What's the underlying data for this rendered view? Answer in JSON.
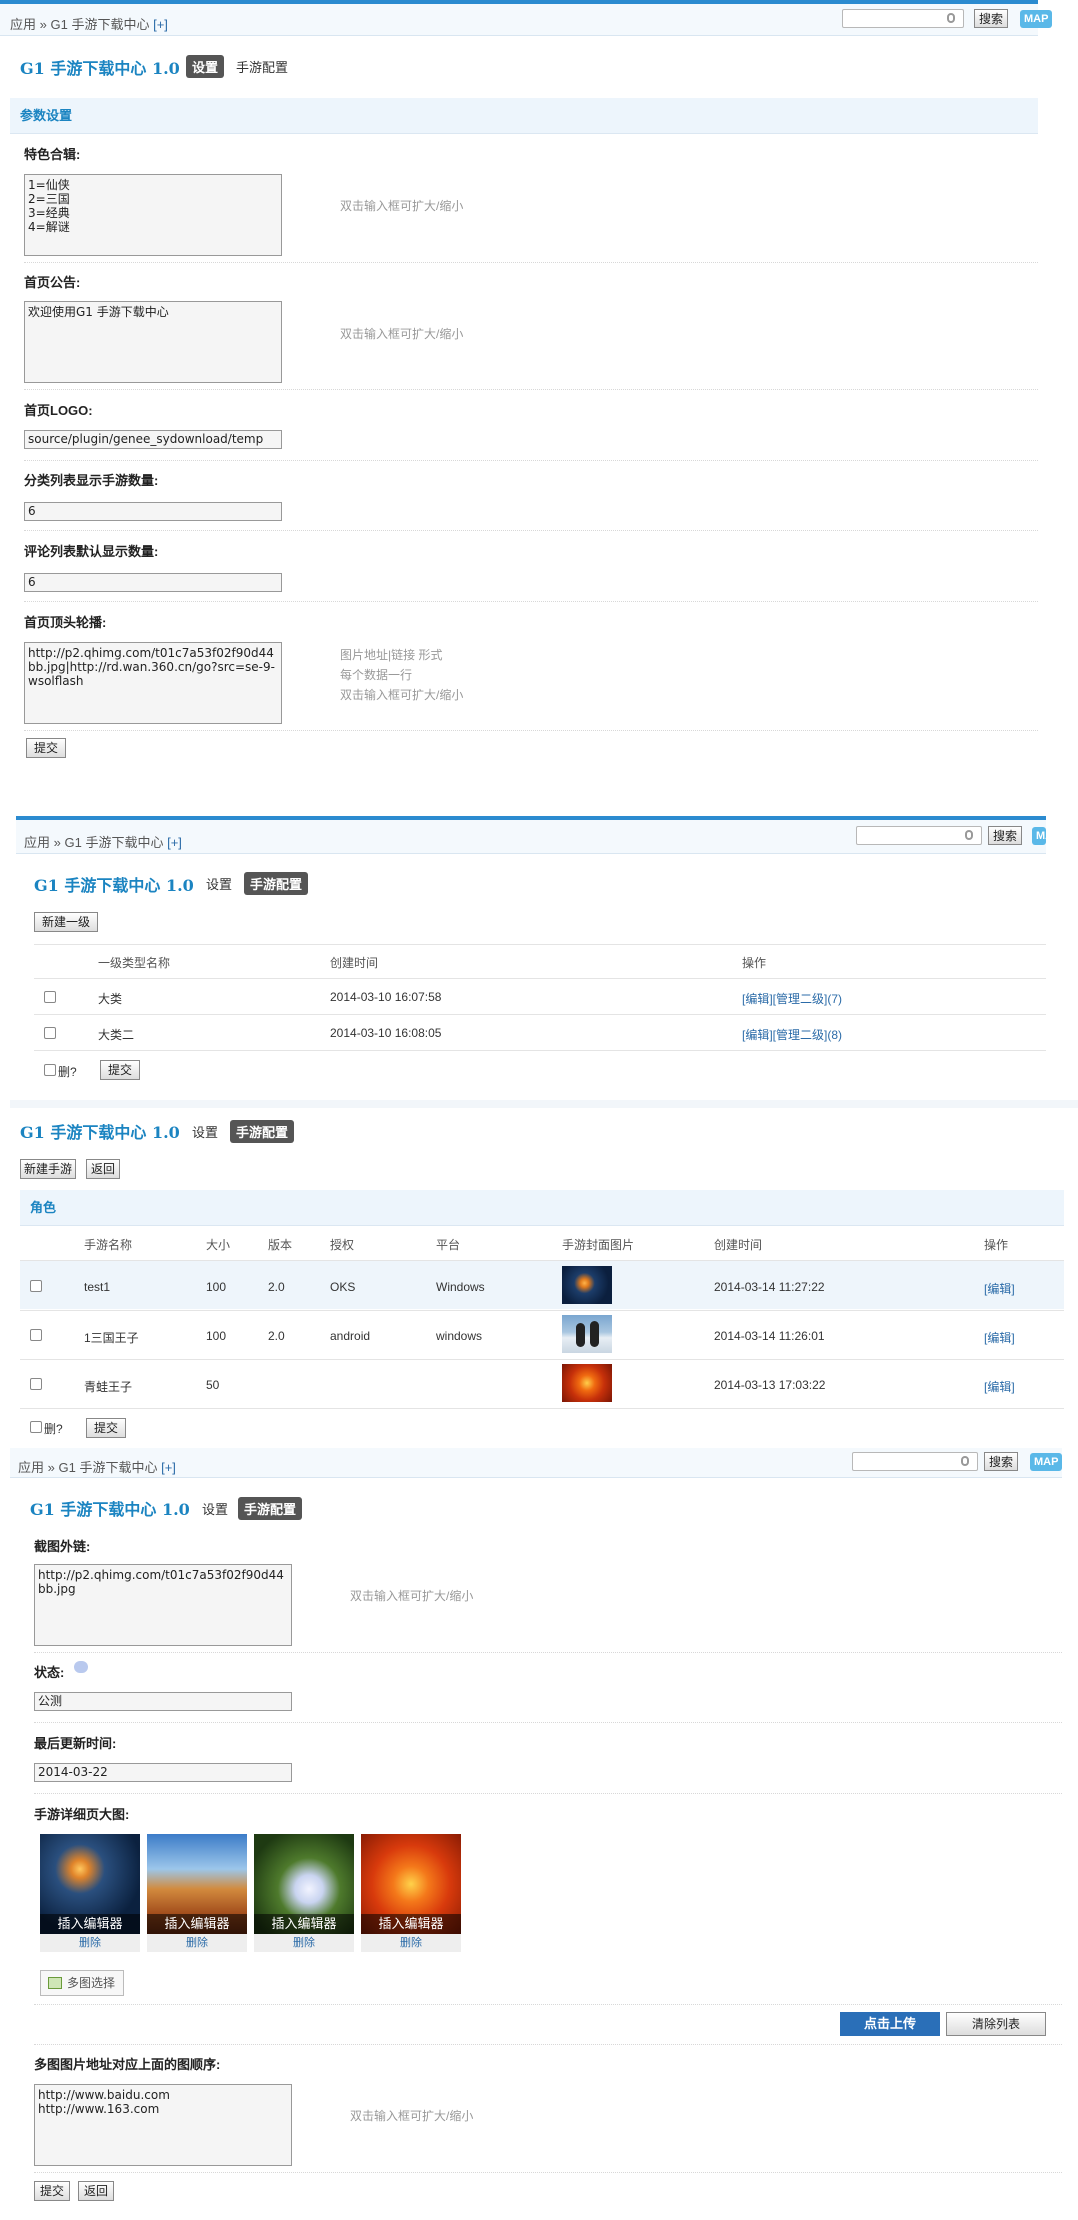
{
  "crumb": {
    "app": "应用",
    "sep": "»",
    "name": "G1 手游下载中心",
    "plus": "[+]"
  },
  "search_btn": "搜索",
  "map": "MAP",
  "app_title": "G1 手游下载中心 1.0",
  "tab_settings": "设置",
  "tab_config": "手游配置",
  "s1": {
    "section": "参数设置",
    "f1_label": "特色合辑:",
    "f1_value": "1=仙侠\n2=三国\n3=经典\n4=解谜",
    "hint": "双击输入框可扩大/缩小",
    "f2_label": "首页公告:",
    "f2_value": "欢迎使用G1 手游下载中心",
    "f3_label": "首页LOGO:",
    "f3_value": "source/plugin/genee_sydownload/temp",
    "f4_label": "分类列表显示手游数量:",
    "f4_value": "6",
    "f5_label": "评论列表默认显示数量:",
    "f5_value": "6",
    "f6_label": "首页顶头轮播:",
    "f6_value": "http://p2.qhimg.com/t01c7a53f02f90d44bb.jpg|http://rd.wan.360.cn/go?src=se-9-wsolflash",
    "f6_hint1": "图片地址|链接 形式",
    "f6_hint2": "每个数据一行",
    "submit": "提交"
  },
  "s2": {
    "new_btn": "新建一级",
    "headers": [
      "一级类型名称",
      "创建时间",
      "操作"
    ],
    "rows": [
      {
        "name": "大类",
        "time": "2014-03-10 16:07:58",
        "ops": "[编辑][管理二级](7)"
      },
      {
        "name": "大类二",
        "time": "2014-03-10 16:08:05",
        "ops": "[编辑][管理二级](8)"
      }
    ],
    "del": "删?",
    "submit": "提交"
  },
  "s3": {
    "new_btn": "新建手游",
    "back_btn": "返回",
    "section": "角色",
    "headers": [
      "手游名称",
      "大小",
      "版本",
      "授权",
      "平台",
      "手游封面图片",
      "创建时间",
      "操作"
    ],
    "rows": [
      {
        "name": "test1",
        "size": "100",
        "ver": "2.0",
        "lic": "OKS",
        "plat": "Windows",
        "time": "2014-03-14 11:27:22",
        "op": "[编辑]"
      },
      {
        "name": "1三国王子",
        "size": "100",
        "ver": "2.0",
        "lic": "android",
        "plat": "windows",
        "time": "2014-03-14 11:26:01",
        "op": "[编辑]"
      },
      {
        "name": "青蛙王子",
        "size": "50",
        "ver": "",
        "lic": "",
        "plat": "",
        "time": "2014-03-13 17:03:22",
        "op": "[编辑]"
      }
    ],
    "del": "删?",
    "submit": "提交"
  },
  "s4": {
    "f1_label": "截图外链:",
    "f1_value": "http://p2.qhimg.com/t01c7a53f02f90d44bb.jpg",
    "f2_label": "状态:",
    "f2_value": "公测",
    "f3_label": "最后更新时间:",
    "f3_value": "2014-03-22",
    "f4_label": "手游详细页大图:",
    "insert": "插入编辑器",
    "delete": "删除",
    "multi": "多图选择",
    "upload": "点击上传",
    "clear": "清除列表",
    "f5_label": "多图图片地址对应上面的图顺序:",
    "f5_value": "http://www.baidu.com\nhttp://www.163.com",
    "submit": "提交",
    "back": "返回"
  }
}
